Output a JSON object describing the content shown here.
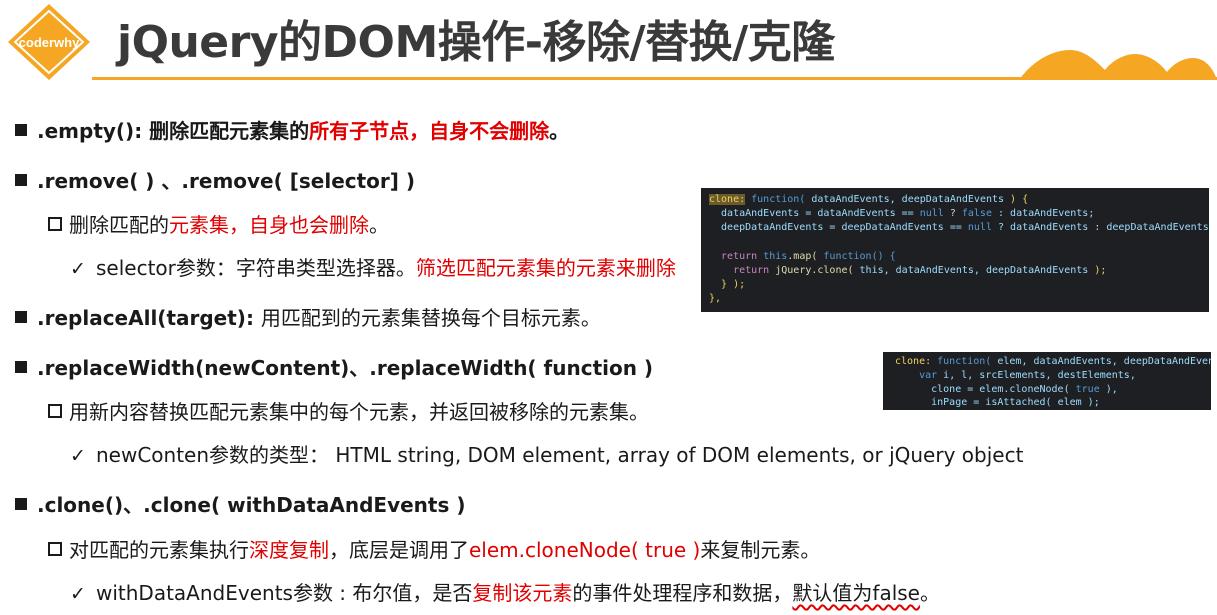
{
  "logo": {
    "text": "coderwhy",
    "color": "#f5a623"
  },
  "title": "jQuery的DOM操作-移除/替换/克隆",
  "accent_color": "#f5a623",
  "highlight_color": "#e00000",
  "items": [
    {
      "a": ".empty():  删除匹配元素集的",
      "b": "所有子节点，自身不会删除",
      "c": "。"
    },
    {
      "a": ".remove( ) 、.remove( [selector] )"
    },
    {
      "a": "删除匹配的",
      "b": "元素集，自身也会删除",
      "c": "。"
    },
    {
      "a": "selector参数：字符串类型选择器。",
      "b": "筛选匹配元素集的元素来删除"
    },
    {
      "a": ".replaceAll(target): ",
      "b": "用匹配到的元素集替换每个目标元素。"
    },
    {
      "a": ".replaceWidth(newContent)、.replaceWidth( function )"
    },
    {
      "a": "用新内容替换匹配元素集中的每个元素，并返回被移除的元素集。"
    },
    {
      "a": "newConten参数的类型：  HTML string, DOM element, array of DOM elements, or jQuery object"
    },
    {
      "a": ".clone()、.clone( withDataAndEvents )"
    },
    {
      "a": "对匹配的元素集执行",
      "b": "深度复制",
      "c": "，底层是调用了",
      "d": "elem.cloneNode( true )",
      "e": "来复制元素。"
    },
    {
      "a": "withDataAndEvents参数 : ",
      "b": "布尔值，是否",
      "c": "复制该元素",
      "d": "的事件处理程序和数据，",
      "e": "默认值为false",
      "f": "。"
    }
  ],
  "code1": [
    {
      "a": "clone:",
      "b": " function(",
      "c": " dataAndEvents, deepDataAndEvents ",
      "d": ") {"
    },
    {
      "a": "  dataAndEvents = dataAndEvents == ",
      "b": "null",
      "c": " ? ",
      "d": "false",
      "e": " : dataAndEvents;"
    },
    {
      "a": "  deepDataAndEvents = deepDataAndEvents == ",
      "b": "null",
      "c": " ? dataAndEvents : deepDataAndEvents;"
    },
    {
      "a": "  return",
      "b": " this",
      "c": ".map(",
      "d": " function() {"
    },
    {
      "a": "    return",
      "b": " jQuery.clone(",
      "c": " this, dataAndEvents, deepDataAndEvents ",
      "d": ");"
    },
    {
      "a": "  } );"
    },
    {
      "a": "},"
    }
  ],
  "code2": [
    {
      "a": "clone:",
      "b": " function(",
      "c": " elem, dataAndEvents, deepDataAndEvents ",
      "d": ") {"
    },
    {
      "a": "    var",
      "b": " i, l, srcElements, destElements,"
    },
    {
      "a": "      clone = elem.cloneNode(",
      "b": " true",
      "c": " ),"
    },
    {
      "a": "      inPage = isAttached(",
      "b": " elem ",
      "c": ");"
    }
  ]
}
